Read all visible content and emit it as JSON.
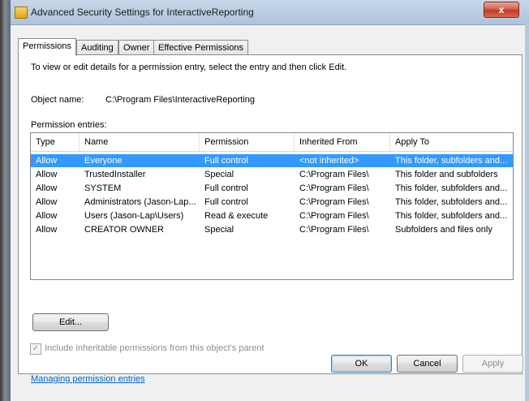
{
  "window": {
    "title": "Advanced Security Settings for InteractiveReporting",
    "close_symbol": "x"
  },
  "tabs": [
    {
      "label": "Permissions"
    },
    {
      "label": "Auditing"
    },
    {
      "label": "Owner"
    },
    {
      "label": "Effective Permissions"
    }
  ],
  "panel": {
    "instructions": "To view or edit details for a permission entry, select the entry and then click Edit.",
    "object_name_label": "Object name:",
    "object_name_value": "C:\\Program Files\\InteractiveReporting",
    "entries_label": "Permission entries:"
  },
  "table": {
    "columns": [
      "Type",
      "Name",
      "Permission",
      "Inherited From",
      "Apply To"
    ],
    "rows": [
      {
        "type": "Allow",
        "name": "Everyone",
        "permission": "Full control",
        "inherited_from": "<not inherited>",
        "apply_to": "This folder, subfolders and..."
      },
      {
        "type": "Allow",
        "name": "TrustedInstaller",
        "permission": "Special",
        "inherited_from": "C:\\Program Files\\",
        "apply_to": "This folder and subfolders"
      },
      {
        "type": "Allow",
        "name": "SYSTEM",
        "permission": "Full control",
        "inherited_from": "C:\\Program Files\\",
        "apply_to": "This folder, subfolders and..."
      },
      {
        "type": "Allow",
        "name": "Administrators (Jason-Lap...",
        "permission": "Full control",
        "inherited_from": "C:\\Program Files\\",
        "apply_to": "This folder, subfolders and..."
      },
      {
        "type": "Allow",
        "name": "Users (Jason-Lap\\Users)",
        "permission": "Read & execute",
        "inherited_from": "C:\\Program Files\\",
        "apply_to": "This folder, subfolders and..."
      },
      {
        "type": "Allow",
        "name": "CREATOR OWNER",
        "permission": "Special",
        "inherited_from": "C:\\Program Files\\",
        "apply_to": "Subfolders and files only"
      }
    ],
    "selected_row": 0
  },
  "edit_button": {
    "label": "Edit..."
  },
  "inherit_checkbox": {
    "label": "Include inheritable permissions from this object's parent",
    "checked": true,
    "enabled": false
  },
  "help_link": {
    "label": "Managing permission entries"
  },
  "footer": {
    "ok_label": "OK",
    "cancel_label": "Cancel",
    "apply_label": "Apply"
  },
  "colors": {
    "selection": "#3399ff",
    "link": "#0066cc",
    "dialog_bg": "#f0f0f0"
  }
}
